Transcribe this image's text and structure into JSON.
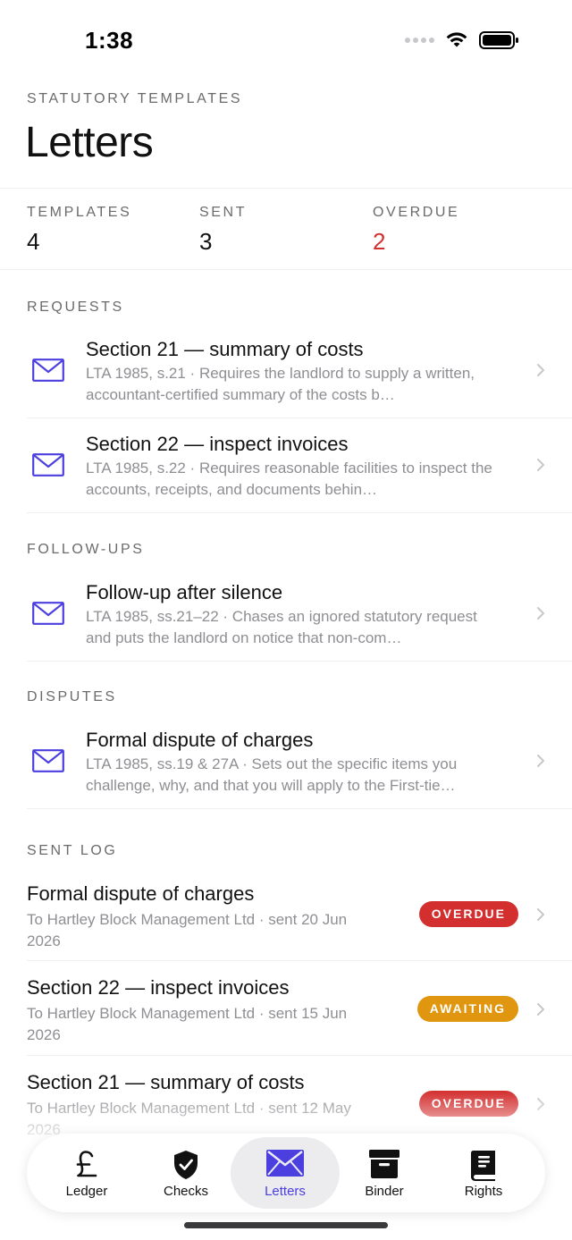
{
  "status_bar": {
    "time": "1:38"
  },
  "header": {
    "eyebrow": "STATUTORY TEMPLATES",
    "title": "Letters"
  },
  "stats": [
    {
      "label": "TEMPLATES",
      "value": "4"
    },
    {
      "label": "SENT",
      "value": "3"
    },
    {
      "label": "OVERDUE",
      "value": "2"
    }
  ],
  "sections": {
    "requests": "REQUESTS",
    "follow_ups": "FOLLOW-UPS",
    "disputes": "DISPUTES",
    "sent_log": "SENT LOG"
  },
  "templates": [
    {
      "title": "Section 21 — summary of costs",
      "desc": "LTA 1985, s.21 · Requires the landlord to supply a written, accountant-certified summary of the costs b…",
      "icon": "envelope-icon"
    },
    {
      "title": "Section 22 — inspect invoices",
      "desc": "LTA 1985, s.22 · Requires reasonable facilities to inspect the accounts, receipts, and documents behin…",
      "icon": "envelope-icon"
    },
    {
      "title": "Follow-up after silence",
      "desc": "LTA 1985, ss.21–22 · Chases an ignored statutory request and puts the landlord on notice that non-com…",
      "icon": "envelope-icon"
    },
    {
      "title": "Formal dispute of charges",
      "desc": "LTA 1985, ss.19 & 27A · Sets out the specific items you challenge, why, and that you will apply to the First-tie…",
      "icon": "envelope-icon"
    }
  ],
  "sent_log": [
    {
      "title": "Formal dispute of charges",
      "desc": "To Hartley Block Management Ltd · sent 20 Jun 2026",
      "badge": "OVERDUE",
      "badge_color": "#d32f2f"
    },
    {
      "title": "Section 22 — inspect invoices",
      "desc": "To Hartley Block Management Ltd · sent 15 Jun 2026",
      "badge": "AWAITING",
      "badge_color": "#e0960e"
    },
    {
      "title": "Section 21 — summary of costs",
      "desc": "To Hartley Block Management Ltd · sent 12 May 2026",
      "badge": "OVERDUE",
      "badge_color": "#d32f2f"
    }
  ],
  "tabs": [
    {
      "label": "Ledger",
      "icon": "pound-icon"
    },
    {
      "label": "Checks",
      "icon": "shield-check-icon"
    },
    {
      "label": "Letters",
      "icon": "envelope-icon",
      "active": true
    },
    {
      "label": "Binder",
      "icon": "archive-box-icon"
    },
    {
      "label": "Rights",
      "icon": "book-icon"
    }
  ],
  "colors": {
    "accent": "#4b3fe0",
    "overdue": "#d32f2f",
    "awaiting": "#e0960e"
  }
}
